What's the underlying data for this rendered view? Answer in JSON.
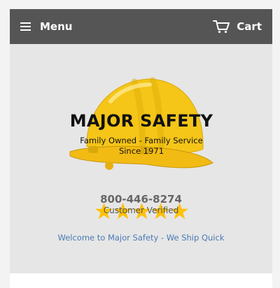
{
  "header": {
    "menu_label": "Menu",
    "menu_icon": "hamburger-menu-icon",
    "cart_label": "Cart",
    "cart_icon": "shopping-cart-icon"
  },
  "logo": {
    "title": "MAJOR SAFETY",
    "line1": "Family Owned - Family Service",
    "line2": "Since 1971",
    "icon": "hard-hat-icon"
  },
  "contact": {
    "phone": "800-446-8274",
    "rating_stars": 5,
    "verified_text": "Customer Verified"
  },
  "welcome_link": "Welcome to Major Safety - We Ship Quick",
  "colors": {
    "navbar": "#555555",
    "body_background": "#e6e6e6",
    "hat_yellow": "#f5c518",
    "star_gold": "#ffc107",
    "link_blue": "#4a7ab5"
  }
}
